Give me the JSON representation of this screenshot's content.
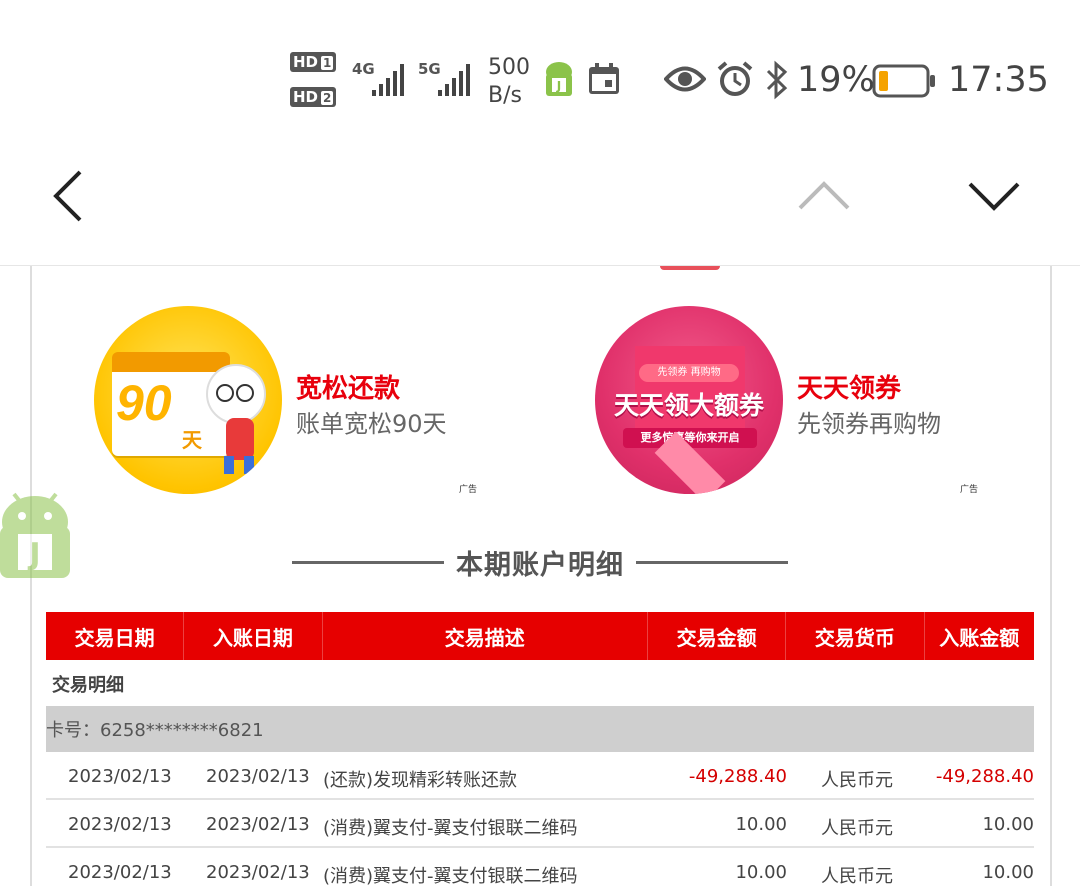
{
  "status_bar": {
    "sim1_label": "HD",
    "sim1_slot": "1",
    "sim2_label": "HD",
    "sim2_slot": "2",
    "net1": "4G",
    "net2": "5G",
    "speed_value": "500",
    "speed_unit": "B/s",
    "battery_percent": "19%",
    "time": "17:35",
    "icons": [
      "android-app-icon",
      "calendar-icon",
      "eye-icon",
      "alarm-icon",
      "bluetooth-icon",
      "battery-icon"
    ]
  },
  "nav": {
    "icons": [
      "back-arrow-icon",
      "chevron-up-icon",
      "chevron-down-icon"
    ]
  },
  "promos": [
    {
      "badge_text": "90",
      "badge_suffix": "天",
      "title": "宽松还款",
      "subtitle": "账单宽松90天",
      "ad_tag": "广告"
    },
    {
      "badge_top": "先领券 再购物",
      "badge_text": "天天领大额券",
      "badge_bottom": "更多惊喜等你来开启",
      "title": "天天领券",
      "subtitle": "先领券再购物",
      "ad_tag": "广告"
    }
  ],
  "section_title": "本期账户明细",
  "table": {
    "headers": [
      "交易日期",
      "入账日期",
      "交易描述",
      "交易金额",
      "交易货币",
      "入账金额"
    ],
    "group_label": "交易明细",
    "card_label": "卡号：6258********6821",
    "rows": [
      {
        "trans_date": "2023/02/13",
        "post_date": "2023/02/13",
        "desc": "(还款)发现精彩转账还款",
        "amount": "-49,288.40",
        "currency": "人民币元",
        "post_amount": "-49,288.40",
        "negative": true
      },
      {
        "trans_date": "2023/02/13",
        "post_date": "2023/02/13",
        "desc": "(消费)翼支付-翼支付银联二维码",
        "amount": "10.00",
        "currency": "人民币元",
        "post_amount": "10.00",
        "negative": false
      },
      {
        "trans_date": "2023/02/13",
        "post_date": "2023/02/13",
        "desc": "(消费)翼支付-翼支付银联二维码",
        "amount": "10.00",
        "currency": "人民币元",
        "post_amount": "10.00",
        "negative": false
      }
    ]
  },
  "colors": {
    "accent_red": "#e60000",
    "negative_amount": "#d40000",
    "battery_low": "#f5a300"
  }
}
